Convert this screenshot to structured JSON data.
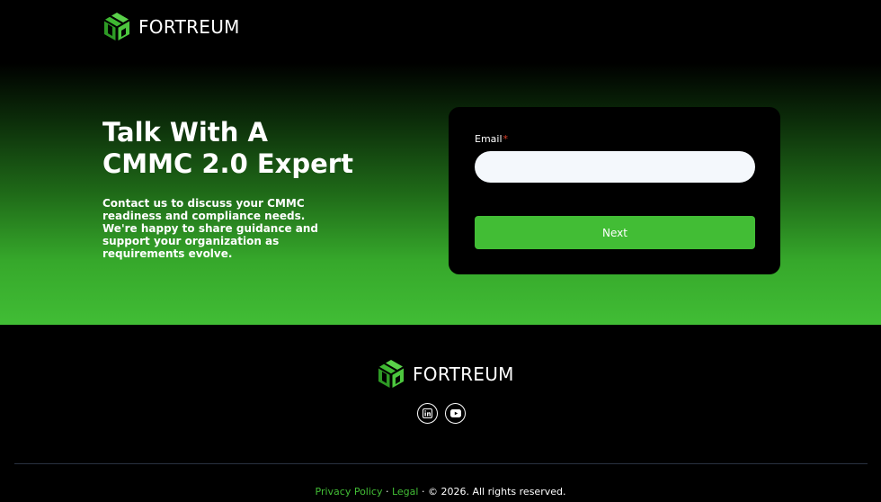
{
  "brand": {
    "name": "FORTREUM",
    "colors": {
      "accent": "#42bd35",
      "accent_dark": "#2e8f25",
      "background": "#000000"
    }
  },
  "hero": {
    "headline_line1": "Talk With A",
    "headline_line2": "CMMC 2.0 Expert",
    "subtext": "Contact us to discuss your CMMC readiness and compliance needs. We're happy to share guidance and support your organization as requirements evolve."
  },
  "form": {
    "email_label": "Email",
    "required_marker": "*",
    "email_value": "",
    "email_placeholder": "",
    "next_label": "Next"
  },
  "footer": {
    "social_icons": [
      "linkedin-icon",
      "youtube-icon"
    ],
    "privacy_label": "Privacy Policy",
    "separator1": " · ",
    "legal_label": "Legal",
    "copyright": " · © 2026. All rights reserved."
  }
}
